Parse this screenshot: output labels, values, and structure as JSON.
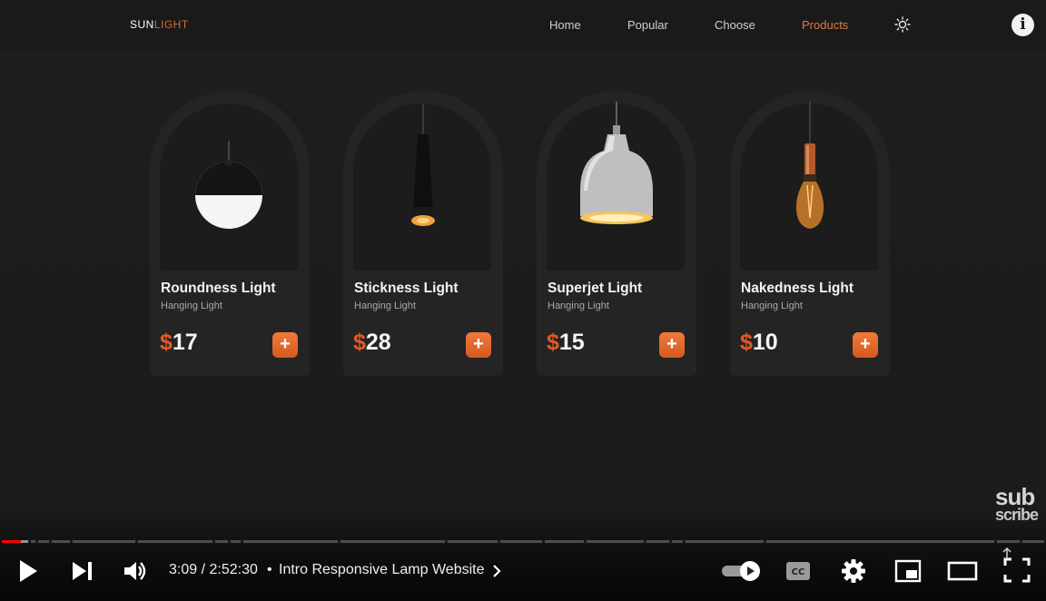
{
  "site": {
    "logo_a": "SUN",
    "logo_b": "LIGHT",
    "nav": [
      "Home",
      "Popular",
      "Choose",
      "Products"
    ],
    "active_nav": "Products",
    "accent_color": "#e25a25"
  },
  "products": [
    {
      "title": "Roundness Light",
      "subtitle": "Hanging Light",
      "currency": "$",
      "price": "17",
      "add_label": "+"
    },
    {
      "title": "Stickness Light",
      "subtitle": "Hanging Light",
      "currency": "$",
      "price": "28",
      "add_label": "+"
    },
    {
      "title": "Superjet Light",
      "subtitle": "Hanging Light",
      "currency": "$",
      "price": "15",
      "add_label": "+"
    },
    {
      "title": "Nakedness Light",
      "subtitle": "Hanging Light",
      "currency": "$",
      "price": "10",
      "add_label": "+"
    }
  ],
  "watermark": {
    "line1": "sub",
    "line2": "scribe"
  },
  "player": {
    "time": "3:09 / 2:52:30",
    "separator": "•",
    "chapter_title": "Intro Responsive Lamp Website",
    "played_fraction": 0.0183,
    "buffered_fraction": 0.028,
    "progress_color": "#ff0000",
    "icons": [
      "play-icon",
      "next-icon",
      "volume-icon",
      "autoplay-toggle-icon",
      "captions-icon",
      "settings-icon",
      "miniplayer-icon",
      "theater-icon",
      "fullscreen-icon"
    ]
  }
}
